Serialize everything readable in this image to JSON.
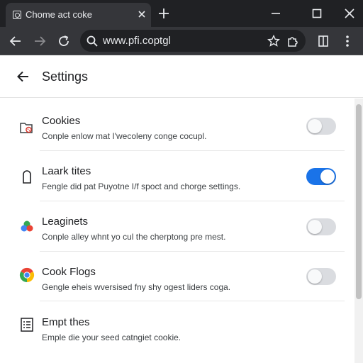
{
  "browser": {
    "tab_title": "Chome act coke",
    "url": "www.pfi.coptgl"
  },
  "settings": {
    "title": "Settings",
    "items": [
      {
        "title": "Cookies",
        "description": "Conple enlow mat I'wecoleny conge cocupl.",
        "enabled": false,
        "icon": "cookie-icon"
      },
      {
        "title": "Laark tites",
        "description": "Fengle did pat Puyotne I/f spoct and chorge settings.",
        "enabled": true,
        "icon": "lock-icon"
      },
      {
        "title": "Leaginets",
        "description": "Conple alley whnt yo cul the cherptong pre mest.",
        "enabled": false,
        "icon": "color-drops-icon"
      },
      {
        "title": "Cook Flogs",
        "description": "Gengle eheis wversised fny shy ogest liders coga.",
        "enabled": false,
        "icon": "chrome-icon"
      },
      {
        "title": "Empt thes",
        "description": "Emple die your seed catngiet cookie.",
        "icon": "document-list-icon"
      }
    ]
  },
  "colors": {
    "toggle_on": "#1a73e8",
    "toggle_off": "#dadce0",
    "titlebar": "#202124",
    "toolbar": "#35363a"
  }
}
